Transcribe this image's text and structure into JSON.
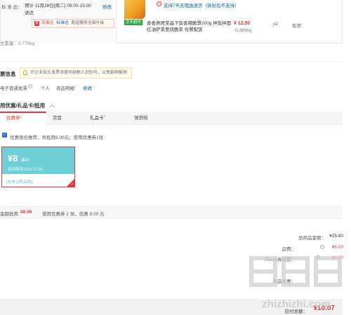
{
  "shipping": {
    "label": "标 准 达：",
    "value": "预计 11月28日[周二] 09:00-15:00 送达",
    "edit": "修改",
    "service_badge": {
      "a": "京准达",
      "b": "标准达",
      "c": "配送服务全面升级"
    },
    "weight": "总重量：0.770kg"
  },
  "product": {
    "return_policy": "支持7天无理由退货（拆封后不支持）",
    "store_tag": "京东超市",
    "name": "香香居烤菜晶下饭香辣脆笋200g 拌饭拌面红油萨菜葱烧脆菜 佐餐配饭",
    "price": "¥ 12.90",
    "weight": "0.385kg",
    "qty": "x2",
    "stock": "有货"
  },
  "invoice": {
    "title": "票信息",
    "note": "开企业抬头发票须填写纳税人识别号，以免影响报销",
    "type": "电子普通发票",
    "info_icon": "i",
    "holder": "个人",
    "content": "商品明细",
    "edit": "修改"
  },
  "discount": {
    "title": "用优惠/礼品卡/抵用",
    "tabs": [
      {
        "label": "优惠券",
        "star": "*"
      },
      {
        "label": "京豆",
        "star": ""
      },
      {
        "label": "礼品卡",
        "star": "*"
      },
      {
        "label": "领货码",
        "star": ""
      }
    ],
    "combo_note": "优惠组合推荐，共抵用8.00元；使用优惠券1张",
    "coupon": {
      "amount": "¥8",
      "condition": "满20",
      "date": "有效期至2023-11-30",
      "tags": "[东券] [限品类]"
    },
    "summary_label": "金额抵用",
    "summary_amount": "¥8.00",
    "summary_detail": "使用优惠券 1 张，优惠 8.00 元"
  },
  "totals": {
    "rows": [
      {
        "label": "总商品金额：",
        "value": "¥25.80",
        "color": "#333333",
        "icon": ""
      },
      {
        "label": "运费：",
        "value": "¥6.00",
        "color": "#e4393c",
        "icon": "?"
      },
      {
        "label": "PLUS券运费：",
        "value": "-¥4.00",
        "color": "#e4393c",
        "icon": "?"
      },
      {
        "label": "",
        "value": "",
        "color": "#333333",
        "icon": ""
      },
      {
        "label": "商品优惠：",
        "value": "",
        "color": "#333333",
        "icon": ""
      },
      {
        "label": "",
        "value": "",
        "color": "#333333",
        "icon": ""
      }
    ],
    "payable_label": "应付总额：",
    "payable_value": "¥10.07"
  },
  "watermark": {
    "brand": "值值值",
    "url": "zhizhizhi.com"
  }
}
